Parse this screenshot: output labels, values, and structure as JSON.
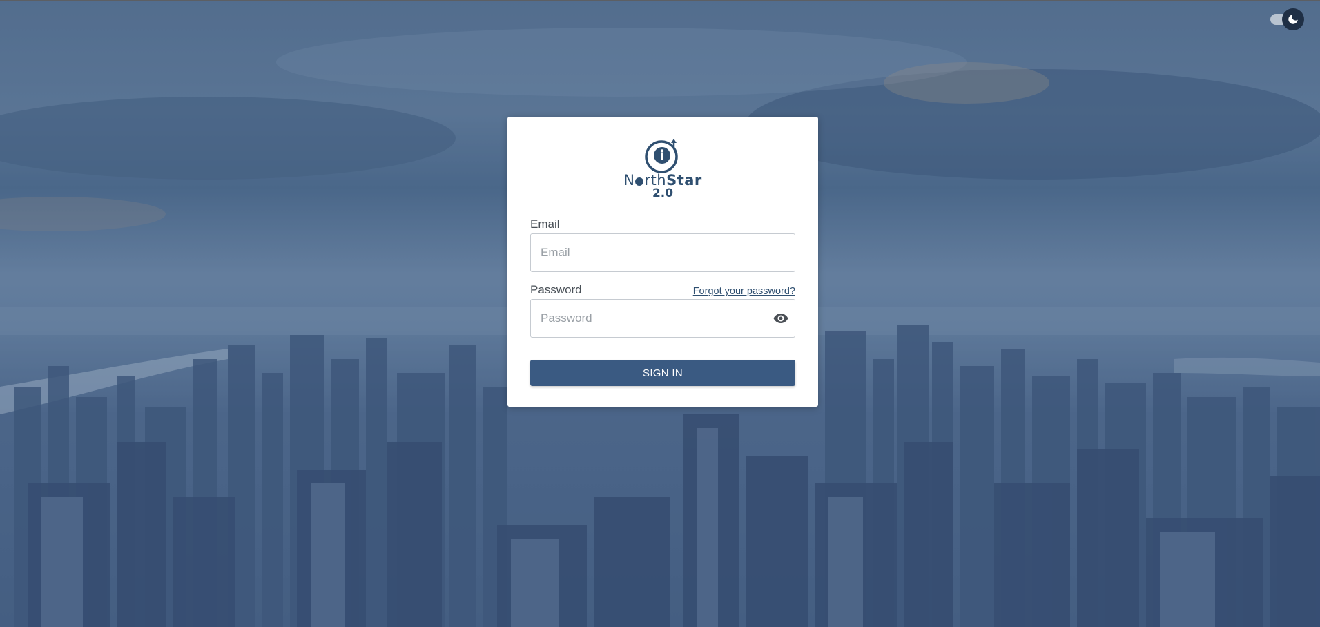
{
  "brand": {
    "name_prefix": "N",
    "name_rest_thin": "rth",
    "name_bold": "Star",
    "version": "2.0"
  },
  "login": {
    "email_label": "Email",
    "email_placeholder": "Email",
    "email_value": "",
    "password_label": "Password",
    "password_placeholder": "Password",
    "password_value": "",
    "forgot_link": "Forgot your password?",
    "submit_label": "SIGN IN"
  },
  "theme_toggle": {
    "icon": "moon-icon",
    "state": "off"
  },
  "colors": {
    "accent": "#3a5a82",
    "brand_text": "#2f4f70",
    "card_bg": "#ffffff",
    "overlay": "#4f6b8a"
  },
  "icons": {
    "password_toggle": "eye-icon",
    "logo_mark": "info-circle-arrow-icon"
  }
}
